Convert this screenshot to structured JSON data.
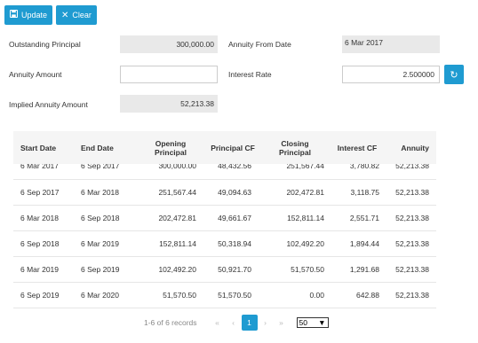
{
  "toolbar": {
    "update_label": "Update",
    "clear_label": "Clear"
  },
  "form": {
    "outstanding_principal_label": "Outstanding Principal",
    "outstanding_principal_value": "300,000.00",
    "annuity_from_date_label": "Annuity From Date",
    "annuity_from_date_value": "6 Mar 2017",
    "annuity_amount_label": "Annuity Amount",
    "annuity_amount_value": "",
    "interest_rate_label": "Interest Rate",
    "interest_rate_value": "2.500000",
    "implied_annuity_label": "Implied Annuity Amount",
    "implied_annuity_value": "52,213.38"
  },
  "table": {
    "headers": {
      "start": "Start Date",
      "end": "End Date",
      "open1": "Opening",
      "open2": "Principal",
      "pcf": "Principal CF",
      "close1": "Closing",
      "close2": "Principal",
      "icf": "Interest CF",
      "annuity": "Annuity"
    },
    "rows": [
      [
        "6 Mar 2017",
        "6 Sep 2017",
        "300,000.00",
        "48,432.56",
        "251,567.44",
        "3,780.82",
        "52,213.38"
      ],
      [
        "6 Sep 2017",
        "6 Mar 2018",
        "251,567.44",
        "49,094.63",
        "202,472.81",
        "3,118.75",
        "52,213.38"
      ],
      [
        "6 Mar 2018",
        "6 Sep 2018",
        "202,472.81",
        "49,661.67",
        "152,811.14",
        "2,551.71",
        "52,213.38"
      ],
      [
        "6 Sep 2018",
        "6 Mar 2019",
        "152,811.14",
        "50,318.94",
        "102,492.20",
        "1,894.44",
        "52,213.38"
      ],
      [
        "6 Mar 2019",
        "6 Sep 2019",
        "102,492.20",
        "50,921.70",
        "51,570.50",
        "1,291.68",
        "52,213.38"
      ],
      [
        "6 Sep 2019",
        "6 Mar 2020",
        "51,570.50",
        "51,570.50",
        "0.00",
        "642.88",
        "52,213.38"
      ]
    ]
  },
  "pager": {
    "summary": "1-6 of 6 records",
    "first": "«",
    "prev": "‹",
    "current": "1",
    "next": "›",
    "last": "»",
    "page_size": "50"
  },
  "colors": {
    "accent": "#1f9bd1"
  }
}
